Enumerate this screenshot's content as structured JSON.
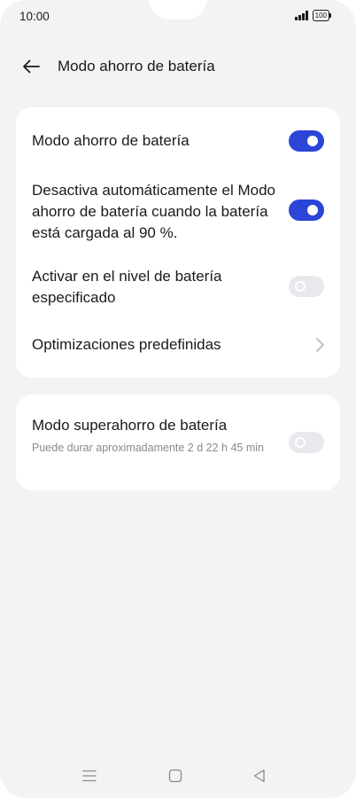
{
  "status_bar": {
    "time": "10:00",
    "battery_level": "100"
  },
  "header": {
    "title": "Modo ahorro de batería"
  },
  "settings": {
    "battery_saver": {
      "label": "Modo ahorro de batería",
      "enabled": true
    },
    "auto_disable": {
      "label": "Desactiva automáticamente el Modo ahorro de batería cuando la batería está cargada al 90 %.",
      "enabled": true
    },
    "activate_at_level": {
      "label": "Activar en el nivel de batería especificado",
      "enabled": false
    },
    "optimizations": {
      "label": "Optimizaciones predefinidas"
    },
    "super_saver": {
      "label": "Modo superahorro de batería",
      "subtitle": "Puede durar aproximadamente 2 d 22 h 45 min",
      "enabled": false
    }
  },
  "colors": {
    "accent": "#2b45d6",
    "background": "#f3f3f5",
    "card": "#ffffff",
    "toggle_off": "#e9e9ed"
  },
  "icons": {
    "back": "arrow-left-icon",
    "chevron": "chevron-right-icon",
    "nav_menu": "menu-icon",
    "nav_home": "home-square-icon",
    "nav_back": "back-triangle-icon"
  }
}
